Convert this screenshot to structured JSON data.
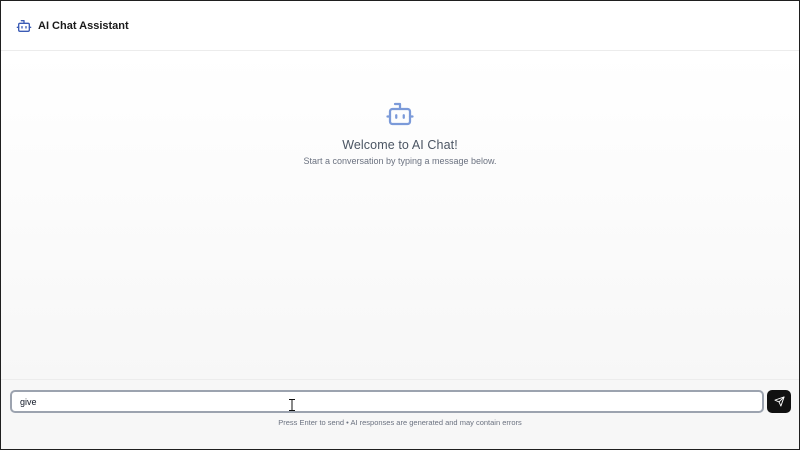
{
  "header": {
    "title": "AI Chat Assistant",
    "icon": "robot-icon"
  },
  "welcome": {
    "icon": "robot-icon",
    "heading": "Welcome to AI Chat!",
    "subtext": "Start a conversation by typing a message below."
  },
  "composer": {
    "value": "give",
    "send_icon": "send-icon",
    "hint": "Press Enter to send • AI responses are generated and may contain errors"
  },
  "colors": {
    "accent": "#5b7fd6",
    "send_button": "#111111"
  }
}
